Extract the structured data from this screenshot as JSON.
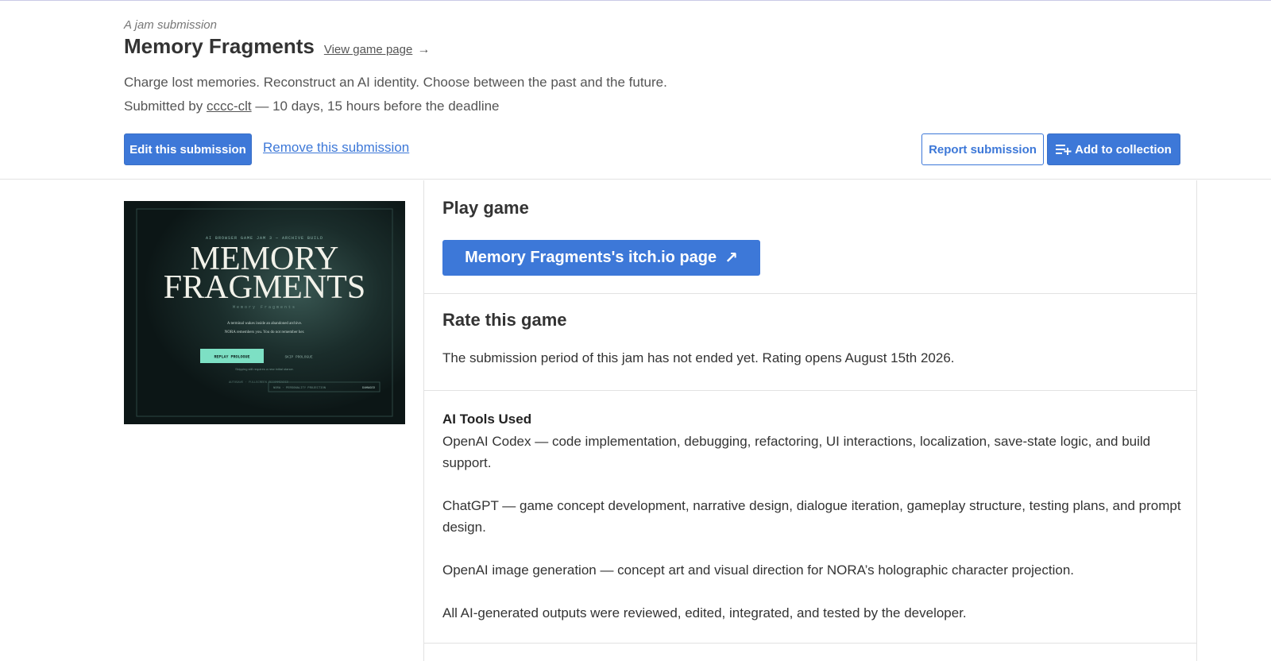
{
  "header": {
    "jam_label": "A jam submission",
    "title": "Memory Fragments",
    "view_link": "View game page",
    "arrow": "→",
    "tagline": "Charge lost memories. Reconstruct an AI identity. Choose between the past and the future.",
    "submitted_prefix": "Submitted by ",
    "submitted_user": "cccc-clt",
    "submitted_suffix": " — 10 days, 15 hours before the deadline",
    "edit_label": "Edit this submission",
    "remove_label": "Remove this submission",
    "report_label": "Report submission",
    "collection_label": "Add to collection"
  },
  "cover": {
    "top_line": "AI BROWSER GAME JAM 3 — ARCHIVE BUILD",
    "title_line1": "MEMORY",
    "title_line2": "FRAGMENTS",
    "subtitle": "Memory Fragments",
    "blurb1": "A terminal wakes inside an abandoned archive.",
    "blurb2": "NORA remembers you. You do not remember her.",
    "primary_btn": "REPLAY PROLOGUE",
    "secondary_btn": "SKIP PROLOGUE",
    "hint": "Skipping still requires a new initial stance.",
    "footer_left": "AUTOSAVE · FULLSCREEN RECOMMENDED",
    "footer_mid": "NORA · PERSONALITY PROJECTION",
    "footer_right": "DAMAGED"
  },
  "play": {
    "heading": "Play game",
    "button": "Memory Fragments's itch.io page",
    "button_icon": "↗"
  },
  "rate": {
    "heading": "Rate this game",
    "text": "The submission period of this jam has not ended yet. Rating opens August 15th 2026."
  },
  "ai": {
    "title": "AI Tools Used",
    "para1": "OpenAI Codex — code implementation, debugging, refactoring, UI interactions, localization, save-state logic, and build support.",
    "para2": "ChatGPT — game concept development, narrative design, dialogue iteration, gameplay structure, testing plans, and prompt design.",
    "para3": "OpenAI image generation — concept art and visual direction for NORA’s holographic character projection.",
    "para4": "All AI-generated outputs were reviewed, edited, integrated, and tested by the developer."
  },
  "colors": {
    "accent": "#3d78d8",
    "cover_bg": "#0f1b1b",
    "cover_button": "#7de0c4"
  }
}
